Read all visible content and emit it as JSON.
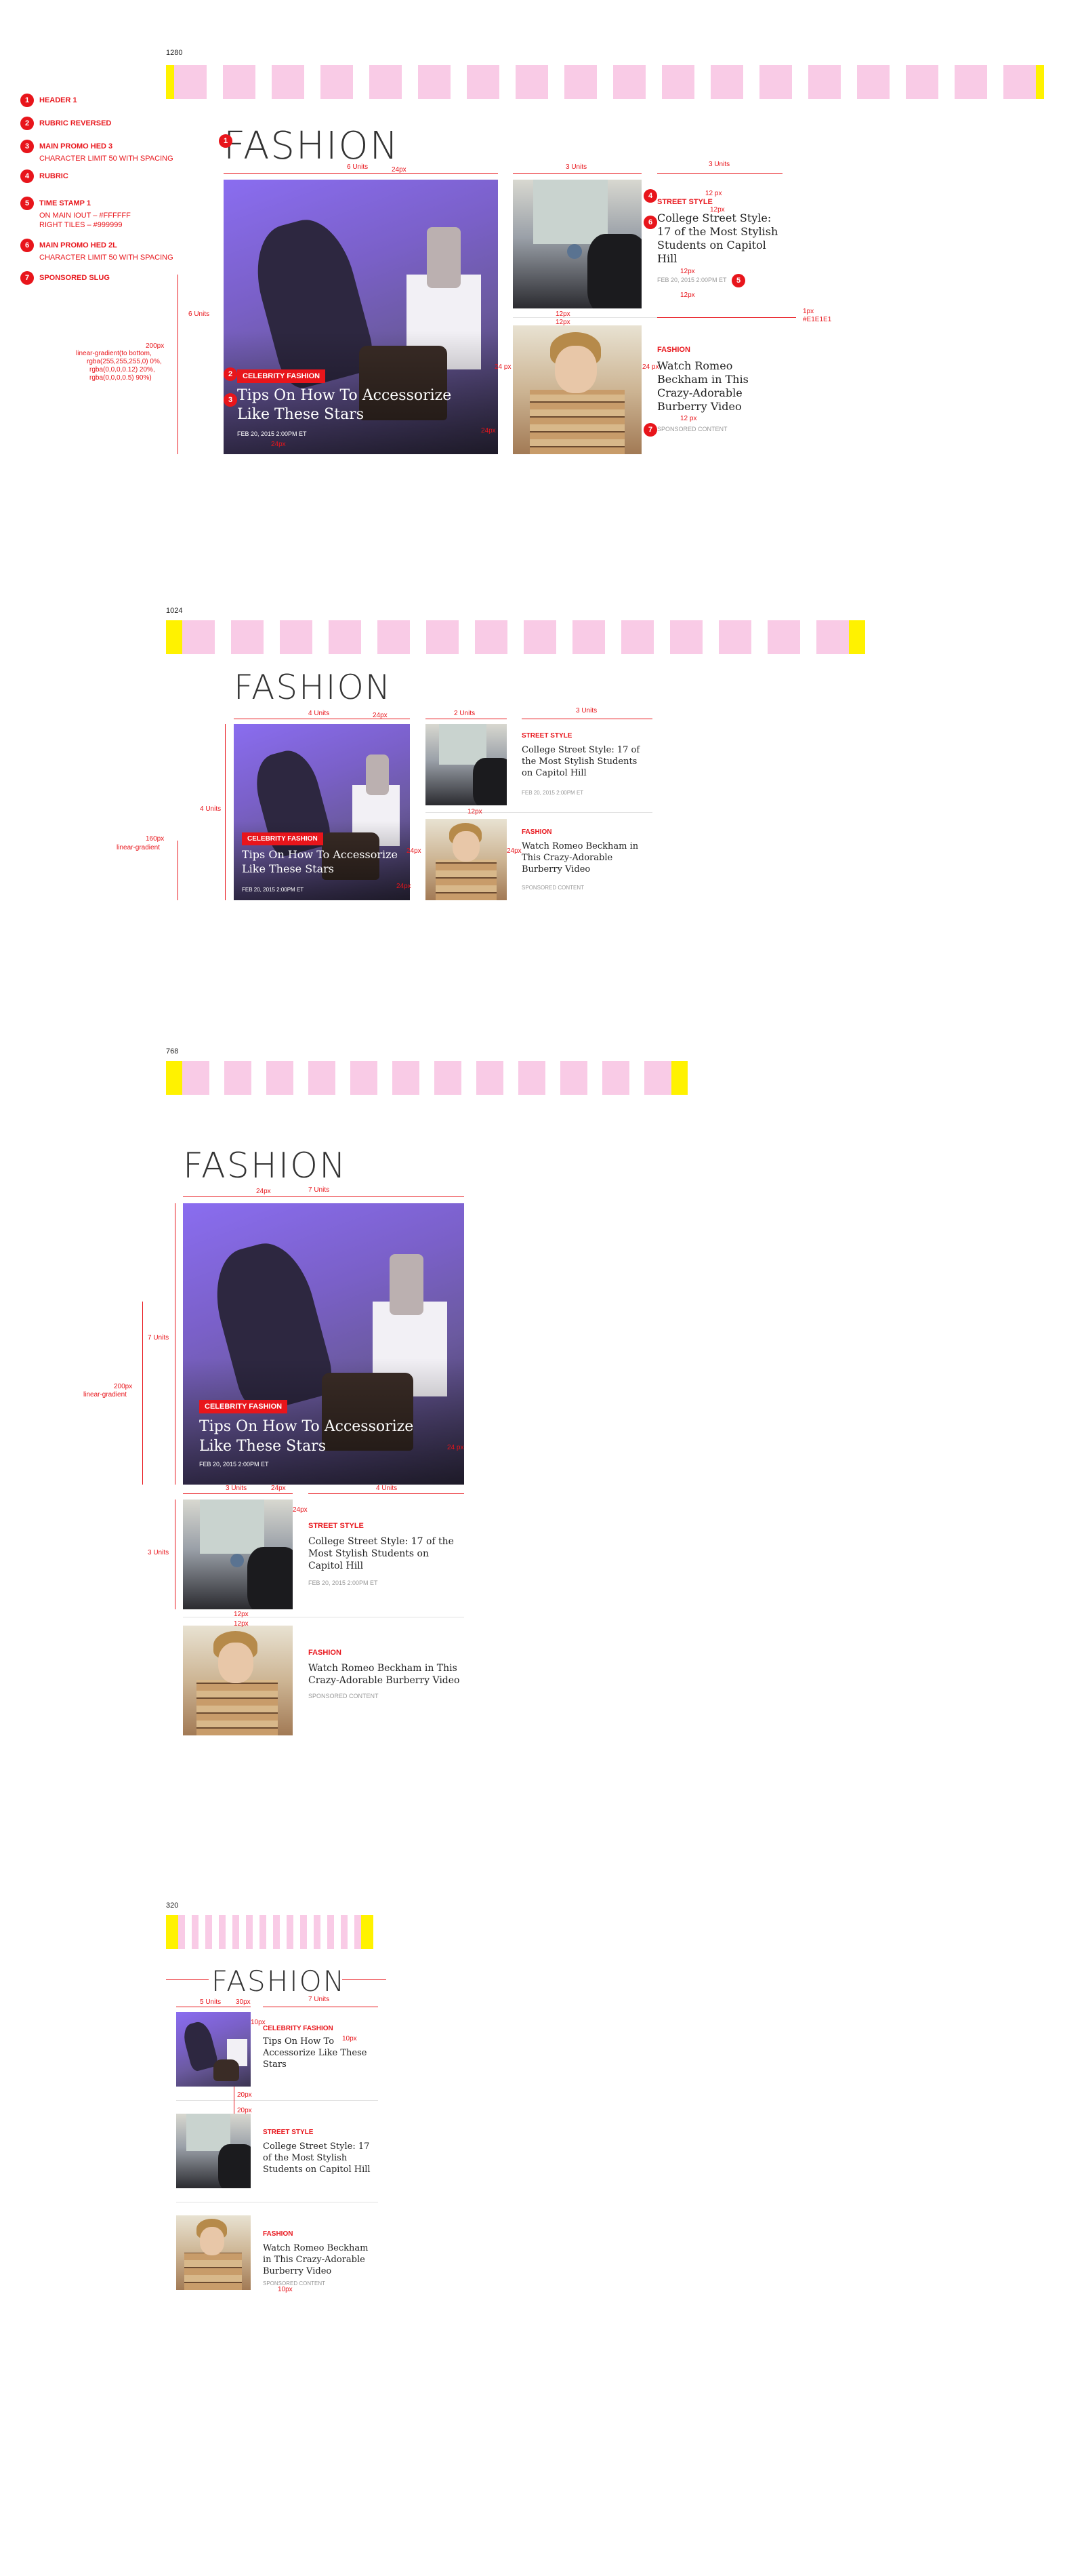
{
  "breakpoints": [
    "1280",
    "1024",
    "768",
    "320"
  ],
  "legend": [
    {
      "num": "1",
      "label": "HEADER 1",
      "sub": ""
    },
    {
      "num": "2",
      "label": "RUBRIC REVERSED",
      "sub": ""
    },
    {
      "num": "3",
      "label": "MAIN PROMO HED 3",
      "sub": "CHARACTER LIMIT 50 WITH SPACING"
    },
    {
      "num": "4",
      "label": "RUBRIC",
      "sub": ""
    },
    {
      "num": "5",
      "label": "TIME STAMP 1",
      "sub": "ON MAIN IOUT – #FFFFFF",
      "sub2": "RIGHT TILES – #999999"
    },
    {
      "num": "6",
      "label": "MAIN PROMO HED 2L",
      "sub": "CHARACTER LIMIT 50 WITH SPACING"
    },
    {
      "num": "7",
      "label": "SPONSORED SLUG",
      "sub": ""
    }
  ],
  "section_title": "FASHION",
  "main_promo": {
    "rubric": "CELEBRITY FASHION",
    "headline": "Tips On How To Accessorize Like These Stars",
    "timestamp": "FEB 20, 2015 2:00PM ET"
  },
  "tile_street": {
    "rubric": "STREET STYLE",
    "headline": "College Street Style: 17 of the Most Stylish Students on Capitol Hill",
    "timestamp": "FEB 20, 2015 2:00PM ET"
  },
  "tile_fashion": {
    "rubric": "FASHION",
    "headline": "Watch Romeo Beckham in This Crazy-Adorable Burberry Video",
    "sponsored": "SPONSORED CONTENT"
  },
  "annotations": {
    "six_units": "6 Units",
    "three_units": "3 Units",
    "four_units": "4 Units",
    "two_units": "2 Units",
    "seven_units": "7 Units",
    "five_units": "5 Units",
    "px24": "24px",
    "px24b": "24 px",
    "px12": "12px",
    "px12b": "12 px",
    "px20": "20px",
    "px10": "10px",
    "px30": "30px",
    "px1": "1px",
    "hex_divider": "#E1E1E1",
    "px200": "200px",
    "px160": "160px",
    "linear_gradient": "linear-gradient",
    "gradient_spec": [
      "linear-gradient(to bottom,",
      "rgba(255,255,255,0) 0%,",
      "rgba(0,0,0,0.12) 20%,",
      "rgba(0,0,0,0.5) 90%)"
    ]
  },
  "colors": {
    "accent": "#e8151b",
    "grid_col": "#f9cbe6",
    "grid_gutter": "#fff200",
    "divider": "#e1e1e1"
  }
}
